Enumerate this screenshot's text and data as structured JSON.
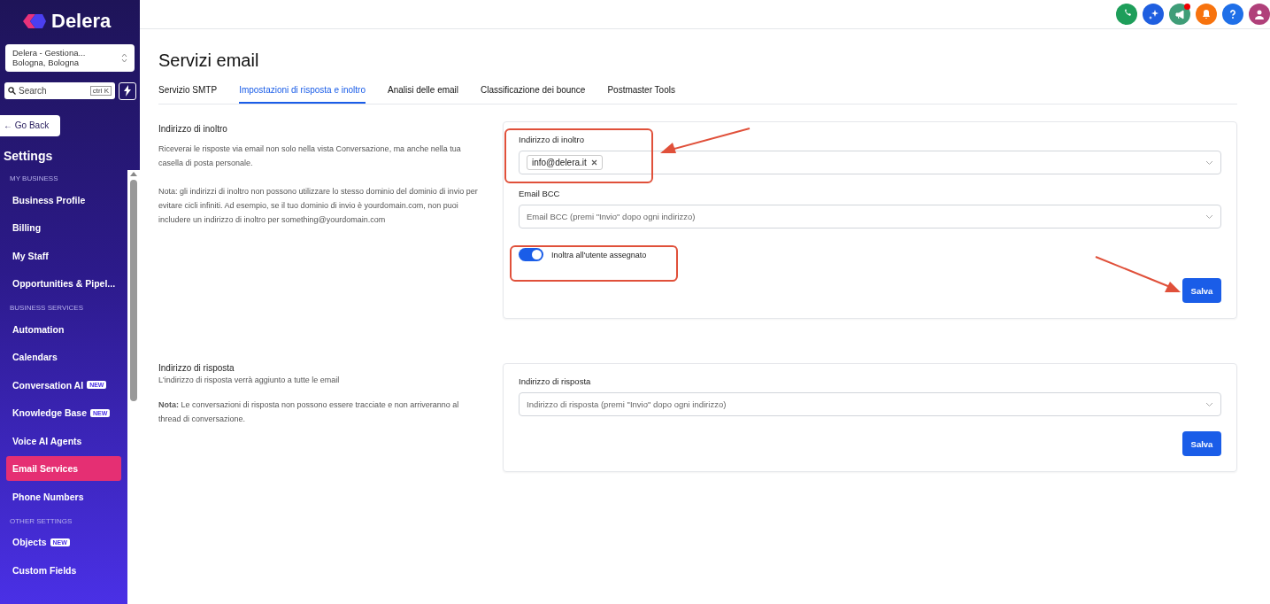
{
  "brand": {
    "name": "Delera"
  },
  "location": {
    "name": "Delera - Gestiona...",
    "city": "Bologna, Bologna"
  },
  "search": {
    "placeholder": "Search",
    "shortcut": "ctrl K"
  },
  "back_button": "← Go Back",
  "sidebar_title": "Settings",
  "sidebar": [
    {
      "kind": "header",
      "label": "MY BUSINESS"
    },
    {
      "kind": "item",
      "label": "Business Profile",
      "selected": false
    },
    {
      "kind": "item",
      "label": "Billing",
      "selected": false
    },
    {
      "kind": "item",
      "label": "My Staff",
      "selected": false
    },
    {
      "kind": "item",
      "label": "Opportunities & Pipel...",
      "selected": false
    },
    {
      "kind": "header",
      "label": "BUSINESS SERVICES"
    },
    {
      "kind": "item",
      "label": "Automation",
      "selected": false
    },
    {
      "kind": "item",
      "label": "Calendars",
      "selected": false
    },
    {
      "kind": "item",
      "label": "Conversation AI",
      "badge": "NEW",
      "selected": false
    },
    {
      "kind": "item",
      "label": "Knowledge Base",
      "badge": "NEW",
      "selected": false
    },
    {
      "kind": "item",
      "label": "Voice AI Agents",
      "selected": false
    },
    {
      "kind": "item",
      "label": "Email Services",
      "selected": true
    },
    {
      "kind": "item",
      "label": "Phone Numbers",
      "selected": false
    },
    {
      "kind": "header",
      "label": "OTHER SETTINGS"
    },
    {
      "kind": "item",
      "label": "Objects",
      "badge": "NEW",
      "selected": false
    },
    {
      "kind": "item",
      "label": "Custom Fields",
      "selected": false
    }
  ],
  "topbar_icons": [
    {
      "kind": "phone",
      "color": "#1e9e5a"
    },
    {
      "kind": "sparkle",
      "color": "#1f5fe0"
    },
    {
      "kind": "megaphone",
      "color": "#3f9d78"
    },
    {
      "kind": "bell",
      "color": "#f7730e"
    },
    {
      "kind": "help",
      "color": "#1f6fe8"
    },
    {
      "kind": "avatar",
      "color": "#b0407a"
    }
  ],
  "page_title": "Servizi email",
  "tabs": [
    {
      "label": "Servizio SMTP",
      "selected": false
    },
    {
      "label": "Impostazioni di risposta e inoltro",
      "selected": true
    },
    {
      "label": "Analisi delle email",
      "selected": false
    },
    {
      "label": "Classificazione dei bounce",
      "selected": false
    },
    {
      "label": "Postmaster Tools",
      "selected": false
    }
  ],
  "forwarding": {
    "title": "Indirizzo di inoltro",
    "description": "Riceverai le risposte via email non solo nella vista Conversazione, ma anche nella tua casella di posta personale.",
    "note": "Nota: gli indirizzi di inoltro non possono utilizzare lo stesso dominio del dominio di invio per evitare cicli infiniti. Ad esempio, se il tuo dominio di invio è yourdomain.com, non puoi includere un indirizzo di inoltro per something@yourdomain.com",
    "field_label": "Indirizzo di inoltro",
    "tags": [
      "info@delera.it"
    ],
    "bcc_label": "Email BCC",
    "bcc_placeholder": "Email BCC (premi \"Invio\" dopo ogni indirizzo)",
    "toggle": {
      "label": "Inoltra all'utente assegnato",
      "on": true
    },
    "save": "Salva"
  },
  "reply": {
    "title": "Indirizzo di risposta",
    "description": "L'indirizzo di risposta verrà aggiunto a tutte le email",
    "note": "**Nota:** Le conversazioni di risposta non possono essere tracciate e non arriveranno al thread di conversazione.",
    "field_label": "Indirizzo di risposta",
    "placeholder": "Indirizzo di risposta (premi \"Invio\" dopo ogni indirizzo)",
    "save": "Salva"
  }
}
